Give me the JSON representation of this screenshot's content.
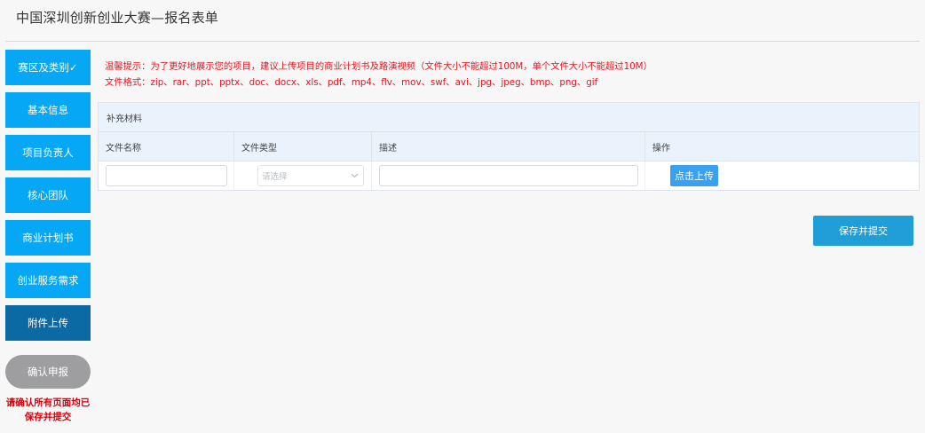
{
  "page": {
    "title": "中国深圳创新创业大赛—报名表单"
  },
  "sidebar": {
    "items": [
      {
        "label": "赛区及类别✓",
        "active": false
      },
      {
        "label": "基本信息",
        "active": false
      },
      {
        "label": "项目负责人",
        "active": false
      },
      {
        "label": "核心团队",
        "active": false
      },
      {
        "label": "商业计划书",
        "active": false
      },
      {
        "label": "创业服务需求",
        "active": false
      },
      {
        "label": "附件上传",
        "active": true
      }
    ],
    "confirm_label": "确认申报",
    "confirm_note": "请确认所有页面均已保存并提交"
  },
  "notice": {
    "line1": "温馨提示：为了更好地展示您的项目，建议上传项目的商业计划书及路演视频（文件大小不能超过100M，单个文件大小不能超过10M）",
    "line2": "文件格式：zip、rar、ppt、pptx、doc、docx、xls、pdf、mp4、flv、mov、swf、avi、jpg、jpeg、bmp、png、gif"
  },
  "panel": {
    "title": "补充材料",
    "columns": [
      "文件名称",
      "文件类型",
      "描述",
      "操作"
    ],
    "row": {
      "file_name_value": "",
      "file_type_placeholder": "请选择",
      "description_value": "",
      "upload_label": "点击上传"
    }
  },
  "actions": {
    "save_label": "保存并提交"
  },
  "colors": {
    "nav": "#06a7f5",
    "nav_active": "#0b6aa3",
    "notice": "#e5141f",
    "save": "#1f9ed8"
  }
}
